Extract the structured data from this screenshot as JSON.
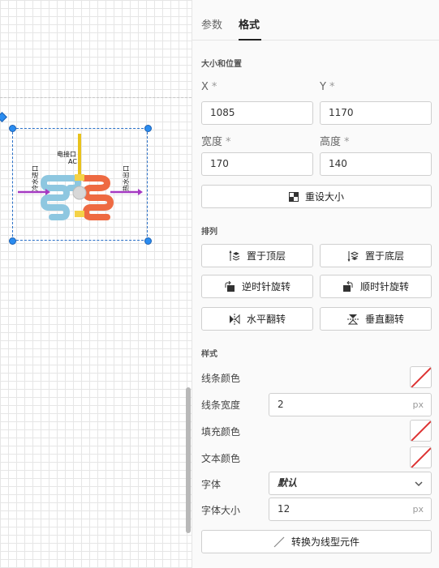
{
  "tabs": {
    "params": "参数",
    "format": "格式"
  },
  "size_position": {
    "title": "大小和位置",
    "x_label": "X",
    "x_value": "1085",
    "y_label": "Y",
    "y_value": "1170",
    "width_label": "宽度",
    "width_value": "170",
    "height_label": "高度",
    "height_value": "140",
    "required_mark": "*",
    "reset_size": "重设大小"
  },
  "arrange": {
    "title": "排列",
    "bring_to_front": "置于顶层",
    "send_to_back": "置于底层",
    "rotate_ccw": "逆时针旋转",
    "rotate_cw": "顺时针旋转",
    "flip_horizontal": "水平翻转",
    "flip_vertical": "垂直翻转"
  },
  "style": {
    "title": "样式",
    "line_color": "线条颜色",
    "line_width": "线条宽度",
    "line_width_value": "2",
    "fill_color": "填充颜色",
    "text_color": "文本颜色",
    "font": "字体",
    "font_value": "默认",
    "font_size": "字体大小",
    "font_size_value": "12",
    "unit_px": "px",
    "convert_button": "转换为线型元件"
  },
  "device": {
    "power_label": "电接口",
    "ac_label": "AC",
    "water_in": "冷水进口",
    "water_out": "热水出口"
  },
  "colors": {
    "cold_coil": "#8ec7e0",
    "hot_coil": "#ee6a42",
    "arrow": "#a53ac2",
    "power_line": "#e8c21c",
    "selection": "#2a8cf0"
  },
  "icons": {
    "swatch": "none-color-icon",
    "select": "chevron-down-icon"
  }
}
